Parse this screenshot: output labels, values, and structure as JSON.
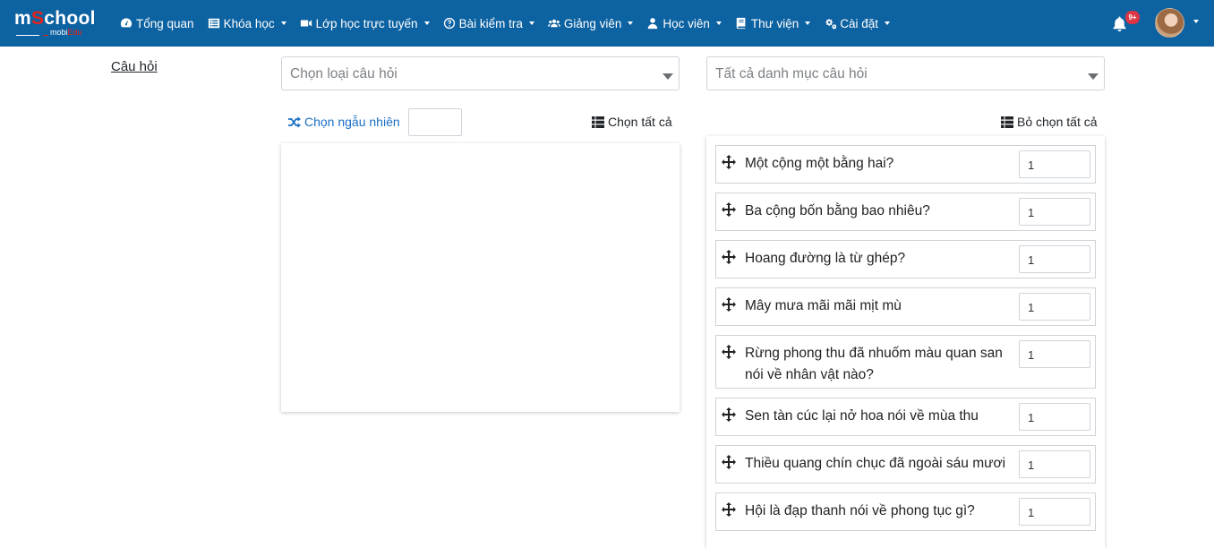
{
  "brand": {
    "logo_text_start": "m",
    "logo_text_ring": "S",
    "logo_text_end": "chool",
    "logo_sub_start": "mobi",
    "logo_sub_end": "Edu"
  },
  "nav": {
    "items": [
      {
        "label": "Tổng quan",
        "icon": "dashboard-icon",
        "dropdown": false
      },
      {
        "label": "Khóa học",
        "icon": "list-icon",
        "dropdown": true
      },
      {
        "label": "Lớp học trực tuyến",
        "icon": "video-icon",
        "dropdown": true
      },
      {
        "label": "Bài kiểm tra",
        "icon": "question-circle-icon",
        "dropdown": true
      },
      {
        "label": "Giảng viên",
        "icon": "users-icon",
        "dropdown": true
      },
      {
        "label": "Học viên",
        "icon": "user-icon",
        "dropdown": true
      },
      {
        "label": "Thư viện",
        "icon": "book-icon",
        "dropdown": true
      },
      {
        "label": "Cài đặt",
        "icon": "cogs-icon",
        "dropdown": true
      }
    ],
    "notification_badge": "9+"
  },
  "page": {
    "section_label": "Câu hỏi",
    "type_select_placeholder": "Chọn loại câu hỏi",
    "category_select_placeholder": "Tất cả danh mục câu hỏi",
    "random_label": "Chọn ngẫu nhiên",
    "random_count_value": "",
    "select_all_label": "Chọn tất cả",
    "deselect_all_label": "Bỏ chọn tất cả"
  },
  "selected_questions": [
    {
      "text": "Một cộng một bằng hai?",
      "score": "1"
    },
    {
      "text": "Ba cộng bốn bằng bao nhiêu?",
      "score": "1"
    },
    {
      "text": "Hoang đường là từ ghép?",
      "score": "1"
    },
    {
      "text": "Mây mưa mãi mãi mịt mù",
      "score": "1"
    },
    {
      "text": "Rừng phong thu đã nhuốm màu quan san nói về nhân vật nào?",
      "score": "1"
    },
    {
      "text": "Sen tàn cúc lại nở hoa nói về mùa thu",
      "score": "1"
    },
    {
      "text": "Thiều quang chín chục đã ngoài sáu mươi",
      "score": "1"
    },
    {
      "text": "Hội là đạp thanh nói về phong tục gì?",
      "score": "1"
    }
  ]
}
